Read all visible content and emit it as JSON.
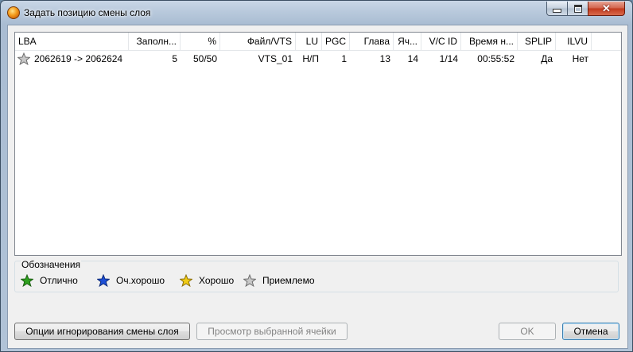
{
  "window": {
    "title": "Задать позицию смены слоя"
  },
  "grid": {
    "columns": [
      "LBA",
      "Заполн...",
      "%",
      "Файл/VTS",
      "LU",
      "PGC",
      "Глава",
      "Яч...",
      "V/C ID",
      "Время н...",
      "SPLIP",
      "ILVU"
    ],
    "rows": [
      {
        "icon": "star-gray-icon",
        "cells": [
          "2062619 -> 2062624",
          "5",
          "50/50",
          "VTS_01",
          "Н/П",
          "1",
          "13",
          "14",
          "1/14",
          "00:55:52",
          "Да",
          "Нет"
        ]
      }
    ]
  },
  "legend": {
    "title": "Обозначения",
    "items": [
      {
        "icon": "star-green-icon",
        "color": "#2fa21e",
        "label": "Отлично"
      },
      {
        "icon": "star-blue-icon",
        "color": "#1d4fd6",
        "label": "Оч.хорошо"
      },
      {
        "icon": "star-yellow-icon",
        "color": "#f1cc14",
        "label": "Хорошо"
      },
      {
        "icon": "star-gray-icon",
        "color": "#c8c8c8",
        "label": "Приемлемо"
      }
    ]
  },
  "buttons": {
    "ignore_options": "Опции игнорирования смены слоя",
    "view_cell": "Просмотр выбранной ячейки",
    "ok": "OK",
    "cancel": "Отмена"
  }
}
